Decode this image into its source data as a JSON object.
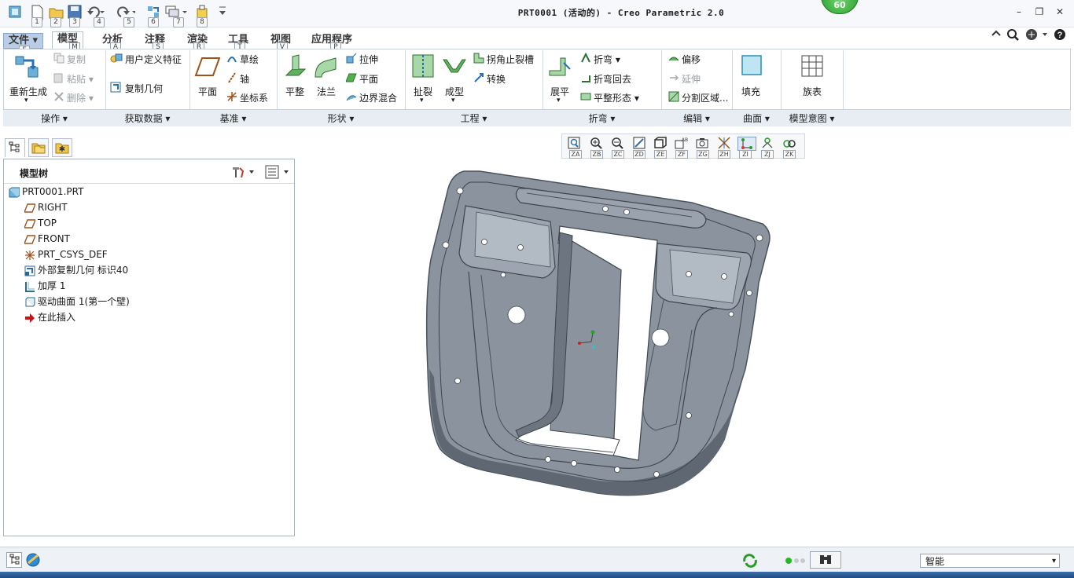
{
  "titlebar": {
    "title": "PRT0001 (活动的) - Creo Parametric 2.0",
    "badge": "60",
    "quick_access_keys": [
      "1",
      "2",
      "3",
      "4",
      "5",
      "6",
      "7",
      "8"
    ],
    "window_controls": [
      "–",
      "❐",
      "✕"
    ]
  },
  "tabs": [
    {
      "label": "文件 ▾",
      "key": "F"
    },
    {
      "label": "模型",
      "key": "M"
    },
    {
      "label": "分析",
      "key": "A"
    },
    {
      "label": "注释",
      "key": "S"
    },
    {
      "label": "渲染",
      "key": "R"
    },
    {
      "label": "工具",
      "key": "T"
    },
    {
      "label": "视图",
      "key": "V"
    },
    {
      "label": "应用程序",
      "key": "P"
    }
  ],
  "ribbon": {
    "operations": {
      "regenerate": "重新生成",
      "copy": "复制",
      "paste": "粘贴",
      "delete": "删除"
    },
    "get_data": {
      "udf": "用户定义特征",
      "copy_geom": "复制几何"
    },
    "datum": {
      "plane": "平面",
      "sketch": "草绘",
      "axis": "轴",
      "csys": "坐标系"
    },
    "shapes": {
      "flat": "平整",
      "flange": "法兰",
      "extrude": "拉伸",
      "plane": "平面",
      "boundary_blend": "边界混合"
    },
    "engineering": {
      "rip": "扯裂",
      "form": "成型",
      "corner_relief": "拐角止裂槽",
      "convert": "转换"
    },
    "bend": {
      "unbend": "展平",
      "bend": "折弯",
      "bend_back": "折弯回去",
      "flatten_form": "平整形态"
    },
    "edit": {
      "offset": "偏移",
      "extend": "延伸",
      "split_area": "分割区域..."
    },
    "surface": {
      "fill": "填充"
    },
    "model_intent": {
      "family_table": "族表"
    },
    "groups": [
      "操作 ▾",
      "获取数据 ▾",
      "基准 ▾",
      "形状 ▾",
      "工程 ▾",
      "折弯 ▾",
      "编辑 ▾",
      "曲面 ▾",
      "模型意图 ▾"
    ]
  },
  "model_tree": {
    "title": "模型树",
    "items": [
      {
        "label": "PRT0001.PRT"
      },
      {
        "label": "RIGHT"
      },
      {
        "label": "TOP"
      },
      {
        "label": "FRONT"
      },
      {
        "label": "PRT_CSYS_DEF"
      },
      {
        "label": "外部复制几何 标识40"
      },
      {
        "label": "加厚 1"
      },
      {
        "label": "驱动曲面 1(第一个壁)"
      },
      {
        "label": "在此插入"
      }
    ]
  },
  "view_toolbar": {
    "keys": [
      "ZA",
      "ZB",
      "ZC",
      "ZD",
      "ZE",
      "ZF",
      "ZG",
      "ZH",
      "ZI",
      "ZJ",
      "ZK"
    ]
  },
  "statusbar": {
    "filter_value": "智能"
  },
  "colors": {
    "part": "#8a939e",
    "part_dark": "#5c646e",
    "ribbon_tab_file": "#b9cde6",
    "badge_green": "#2b9a2b"
  }
}
